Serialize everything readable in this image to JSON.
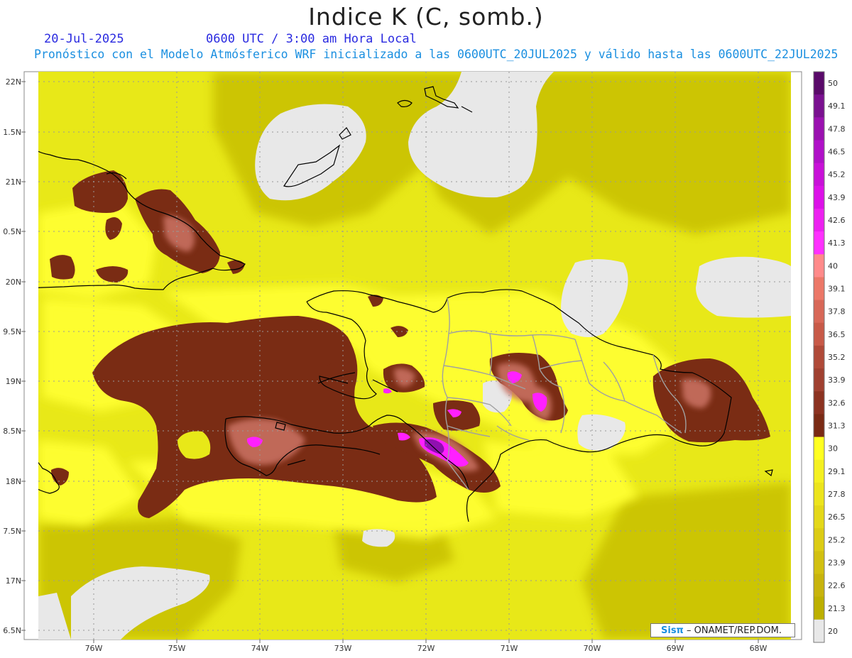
{
  "title": "Indice K (C, somb.)",
  "date": "20-Jul-2025",
  "time_line": "0600 UTC / 3:00 am Hora Local",
  "subtitle": "Pronóstico con el Modelo Atmósferico WRF inicializado a las 0600UTC_20JUL2025 y válido hasta las  0600UTC_22JUL2025",
  "credit": {
    "logo": "Sisπ",
    "text": "– ONAMET/REP.DOM."
  },
  "axes": {
    "lat_labels": [
      "22N",
      "1.5N",
      "21N",
      "0.5N",
      "20N",
      "9.5N",
      "19N",
      "8.5N",
      "18N",
      "7.5N",
      "17N",
      "6.5N"
    ],
    "lon_labels": [
      "76W",
      "75W",
      "74W",
      "73W",
      "72W",
      "71W",
      "70W",
      "69W",
      "68W"
    ]
  },
  "colorbar": {
    "labels": [
      "50",
      "49.1",
      "47.8",
      "46.5",
      "45.2",
      "43.9",
      "42.6",
      "41.3",
      "40",
      "39.1",
      "37.8",
      "36.5",
      "35.2",
      "33.9",
      "32.6",
      "31.3",
      "30",
      "29.1",
      "27.8",
      "26.5",
      "25.2",
      "23.9",
      "22.6",
      "21.3",
      "20"
    ],
    "colors": [
      "#5a0a6a",
      "#7a1090",
      "#9a10b0",
      "#b010c8",
      "#c810d8",
      "#dc10e8",
      "#ec20f0",
      "#ff30ff",
      "#ff8a8a",
      "#ec7868",
      "#d86858",
      "#c85a48",
      "#b04a38",
      "#a04030",
      "#8c3220",
      "#7a2a14",
      "#ffff20",
      "#f4f020",
      "#ece41c",
      "#e4d818",
      "#dccc14",
      "#d2c010",
      "#c8b40c",
      "#bdb000",
      "#e8e8e8"
    ]
  },
  "colors": {
    "base_yellow": "#e8e818",
    "bright_yellow": "#ffff30",
    "olive": "#c8c000",
    "dark_brown": "#7a2c14",
    "pink_brown": "#c87060",
    "magenta": "#ff20ff",
    "purple": "#9010b0",
    "gray": "#e8e8e8",
    "coast": "#000000",
    "border": "#a0a0a0"
  }
}
